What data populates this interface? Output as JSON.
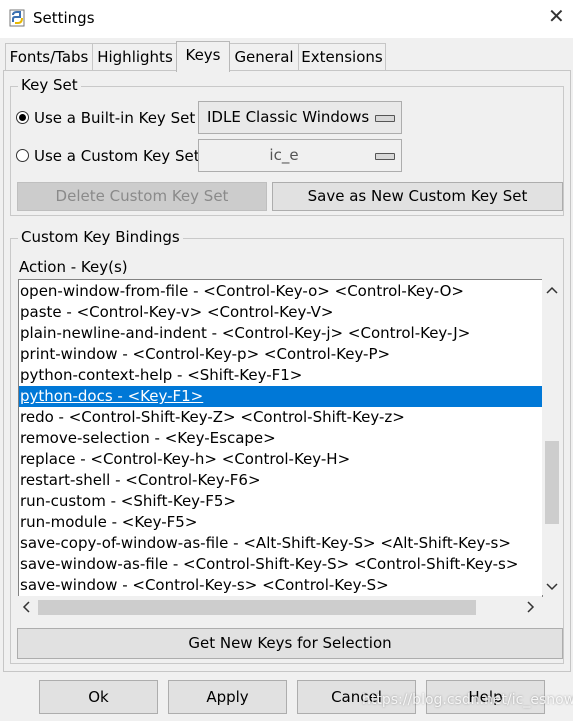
{
  "window": {
    "title": "Settings",
    "close_glyph": "✕"
  },
  "tabs": [
    {
      "label": "Fonts/Tabs",
      "active": false
    },
    {
      "label": "Highlights",
      "active": false
    },
    {
      "label": "Keys",
      "active": true
    },
    {
      "label": "General",
      "active": false
    },
    {
      "label": "Extensions",
      "active": false
    }
  ],
  "key_set": {
    "title": "Key Set",
    "builtin_label": "Use a Built-in Key Set",
    "builtin_selected": true,
    "builtin_value": "IDLE Classic Windows",
    "custom_label": "Use a Custom Key Set",
    "custom_selected": false,
    "custom_value": "ic_e",
    "delete_label": "Delete Custom Key Set",
    "save_new_label": "Save as New Custom Key Set"
  },
  "bindings": {
    "title": "Custom Key Bindings",
    "column_header": "Action - Key(s)",
    "items": [
      "open-window-from-file - <Control-Key-o> <Control-Key-O>",
      "paste - <Control-Key-v> <Control-Key-V>",
      "plain-newline-and-indent - <Control-Key-j> <Control-Key-J>",
      "print-window - <Control-Key-p> <Control-Key-P>",
      "python-context-help - <Shift-Key-F1>",
      "python-docs - <Key-F1>",
      "redo - <Control-Shift-Key-Z> <Control-Shift-Key-z>",
      "remove-selection - <Key-Escape>",
      "replace - <Control-Key-h> <Control-Key-H>",
      "restart-shell - <Control-Key-F6>",
      "run-custom - <Shift-Key-F5>",
      "run-module - <Key-F5>",
      "save-copy-of-window-as-file - <Alt-Shift-Key-S> <Alt-Shift-Key-s>",
      "save-window-as-file - <Control-Shift-Key-S> <Control-Shift-Key-s>",
      "save-window - <Control-Key-s> <Control-Key-S>"
    ],
    "selected_index": 5,
    "get_new_keys_label": "Get New Keys for Selection"
  },
  "footer": {
    "ok_label": "Ok",
    "apply_label": "Apply",
    "cancel_label": "Cancel",
    "help_label": "Help"
  },
  "watermark": "https://blog.csdn.net/ic_esnow",
  "colors": {
    "selection": "#0078d7",
    "background": "#f0f0f0"
  }
}
